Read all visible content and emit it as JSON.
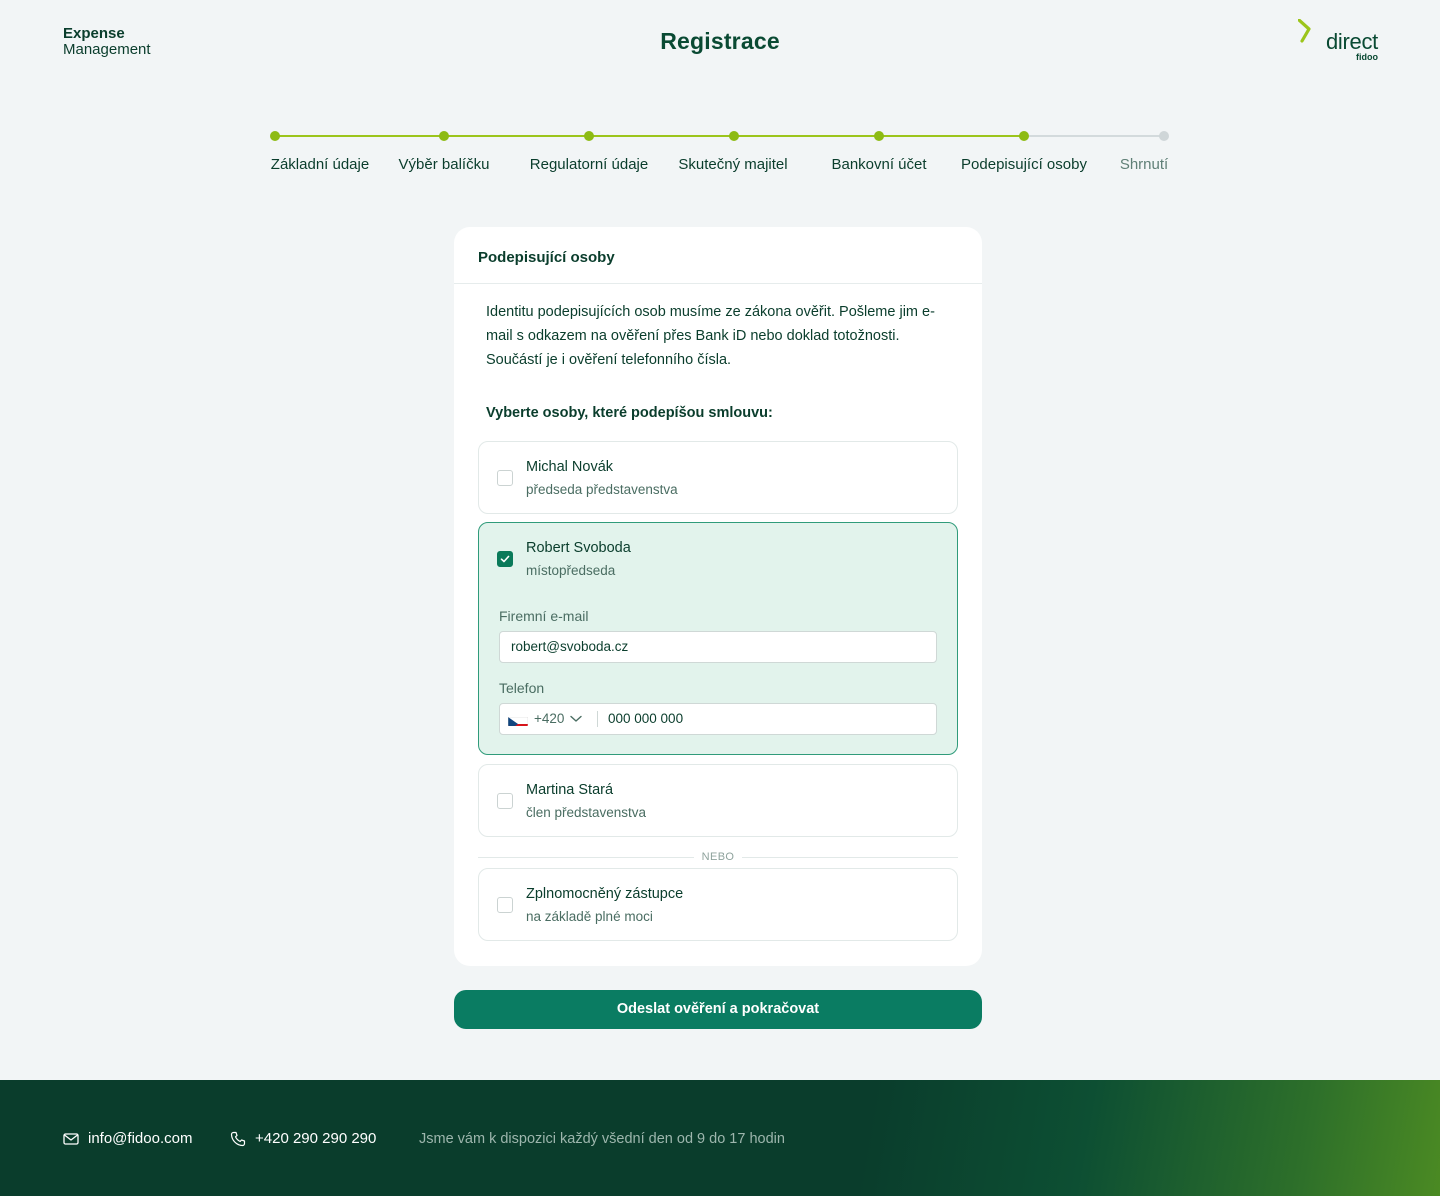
{
  "header": {
    "brand_line1": "Expense",
    "brand_line2": "Management",
    "title": "Registrace",
    "logo_direct": "direct",
    "logo_fidoo": "fidoo"
  },
  "stepper": {
    "steps": [
      {
        "label": "Základní údaje",
        "state": "done"
      },
      {
        "label": "Výběr balíčku",
        "state": "done"
      },
      {
        "label": "Regulatorní údaje",
        "state": "done"
      },
      {
        "label": "Skutečný majitel",
        "state": "done"
      },
      {
        "label": "Bankovní účet",
        "state": "done"
      },
      {
        "label": "Podepisující osoby",
        "state": "active"
      },
      {
        "label": "Shrnutí",
        "state": "todo"
      }
    ]
  },
  "card": {
    "title": "Podepisující osoby",
    "intro": "Identitu podepisujících osob musíme ze zákona ověřit. Pošleme jim e-mail s odkazem na ověření přes Bank iD nebo doklad totožnosti. Součástí je i ověření telefonního čísla.",
    "select_label": "Vyberte osoby, které podepíšou smlouvu:",
    "persons": [
      {
        "name": "Michal Novák",
        "role": "předseda představenstva",
        "checked": false
      },
      {
        "name": "Robert Svoboda",
        "role": "místopředseda",
        "checked": true,
        "email_label": "Firemní e-mail",
        "email_value": "robert@svoboda.cz",
        "phone_label": "Telefon",
        "phone_prefix": "+420",
        "phone_value": "000 000 000"
      },
      {
        "name": "Martina Stará",
        "role": "člen představenstva",
        "checked": false
      }
    ],
    "or_label": "NEBO",
    "proxy": {
      "name": "Zplnomocněný zástupce",
      "role": "na základě plné moci",
      "checked": false
    }
  },
  "submit_label": "Odeslat ověření a pokračovat",
  "footer": {
    "email": "info@fidoo.com",
    "phone": "+420 290 290 290",
    "note": "Jsme vám k dispozici každý všední den od 9 do 17 hodin"
  },
  "colors": {
    "accent": "#0a7c62",
    "progress": "#9cc51b",
    "dark_green": "#0a3d2c",
    "selected_bg": "#e2f3ec"
  }
}
